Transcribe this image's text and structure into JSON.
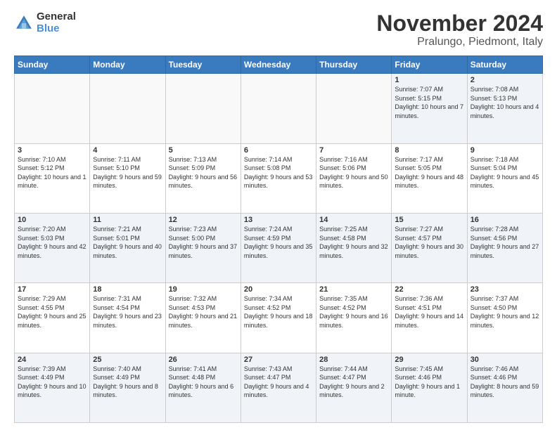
{
  "logo": {
    "general": "General",
    "blue": "Blue"
  },
  "title": "November 2024",
  "subtitle": "Pralungo, Piedmont, Italy",
  "days_header": [
    "Sunday",
    "Monday",
    "Tuesday",
    "Wednesday",
    "Thursday",
    "Friday",
    "Saturday"
  ],
  "weeks": [
    [
      {
        "day": "",
        "info": ""
      },
      {
        "day": "",
        "info": ""
      },
      {
        "day": "",
        "info": ""
      },
      {
        "day": "",
        "info": ""
      },
      {
        "day": "",
        "info": ""
      },
      {
        "day": "1",
        "info": "Sunrise: 7:07 AM\nSunset: 5:15 PM\nDaylight: 10 hours and 7 minutes."
      },
      {
        "day": "2",
        "info": "Sunrise: 7:08 AM\nSunset: 5:13 PM\nDaylight: 10 hours and 4 minutes."
      }
    ],
    [
      {
        "day": "3",
        "info": "Sunrise: 7:10 AM\nSunset: 5:12 PM\nDaylight: 10 hours and 1 minute."
      },
      {
        "day": "4",
        "info": "Sunrise: 7:11 AM\nSunset: 5:10 PM\nDaylight: 9 hours and 59 minutes."
      },
      {
        "day": "5",
        "info": "Sunrise: 7:13 AM\nSunset: 5:09 PM\nDaylight: 9 hours and 56 minutes."
      },
      {
        "day": "6",
        "info": "Sunrise: 7:14 AM\nSunset: 5:08 PM\nDaylight: 9 hours and 53 minutes."
      },
      {
        "day": "7",
        "info": "Sunrise: 7:16 AM\nSunset: 5:06 PM\nDaylight: 9 hours and 50 minutes."
      },
      {
        "day": "8",
        "info": "Sunrise: 7:17 AM\nSunset: 5:05 PM\nDaylight: 9 hours and 48 minutes."
      },
      {
        "day": "9",
        "info": "Sunrise: 7:18 AM\nSunset: 5:04 PM\nDaylight: 9 hours and 45 minutes."
      }
    ],
    [
      {
        "day": "10",
        "info": "Sunrise: 7:20 AM\nSunset: 5:03 PM\nDaylight: 9 hours and 42 minutes."
      },
      {
        "day": "11",
        "info": "Sunrise: 7:21 AM\nSunset: 5:01 PM\nDaylight: 9 hours and 40 minutes."
      },
      {
        "day": "12",
        "info": "Sunrise: 7:23 AM\nSunset: 5:00 PM\nDaylight: 9 hours and 37 minutes."
      },
      {
        "day": "13",
        "info": "Sunrise: 7:24 AM\nSunset: 4:59 PM\nDaylight: 9 hours and 35 minutes."
      },
      {
        "day": "14",
        "info": "Sunrise: 7:25 AM\nSunset: 4:58 PM\nDaylight: 9 hours and 32 minutes."
      },
      {
        "day": "15",
        "info": "Sunrise: 7:27 AM\nSunset: 4:57 PM\nDaylight: 9 hours and 30 minutes."
      },
      {
        "day": "16",
        "info": "Sunrise: 7:28 AM\nSunset: 4:56 PM\nDaylight: 9 hours and 27 minutes."
      }
    ],
    [
      {
        "day": "17",
        "info": "Sunrise: 7:29 AM\nSunset: 4:55 PM\nDaylight: 9 hours and 25 minutes."
      },
      {
        "day": "18",
        "info": "Sunrise: 7:31 AM\nSunset: 4:54 PM\nDaylight: 9 hours and 23 minutes."
      },
      {
        "day": "19",
        "info": "Sunrise: 7:32 AM\nSunset: 4:53 PM\nDaylight: 9 hours and 21 minutes."
      },
      {
        "day": "20",
        "info": "Sunrise: 7:34 AM\nSunset: 4:52 PM\nDaylight: 9 hours and 18 minutes."
      },
      {
        "day": "21",
        "info": "Sunrise: 7:35 AM\nSunset: 4:52 PM\nDaylight: 9 hours and 16 minutes."
      },
      {
        "day": "22",
        "info": "Sunrise: 7:36 AM\nSunset: 4:51 PM\nDaylight: 9 hours and 14 minutes."
      },
      {
        "day": "23",
        "info": "Sunrise: 7:37 AM\nSunset: 4:50 PM\nDaylight: 9 hours and 12 minutes."
      }
    ],
    [
      {
        "day": "24",
        "info": "Sunrise: 7:39 AM\nSunset: 4:49 PM\nDaylight: 9 hours and 10 minutes."
      },
      {
        "day": "25",
        "info": "Sunrise: 7:40 AM\nSunset: 4:49 PM\nDaylight: 9 hours and 8 minutes."
      },
      {
        "day": "26",
        "info": "Sunrise: 7:41 AM\nSunset: 4:48 PM\nDaylight: 9 hours and 6 minutes."
      },
      {
        "day": "27",
        "info": "Sunrise: 7:43 AM\nSunset: 4:47 PM\nDaylight: 9 hours and 4 minutes."
      },
      {
        "day": "28",
        "info": "Sunrise: 7:44 AM\nSunset: 4:47 PM\nDaylight: 9 hours and 2 minutes."
      },
      {
        "day": "29",
        "info": "Sunrise: 7:45 AM\nSunset: 4:46 PM\nDaylight: 9 hours and 1 minute."
      },
      {
        "day": "30",
        "info": "Sunrise: 7:46 AM\nSunset: 4:46 PM\nDaylight: 8 hours and 59 minutes."
      }
    ]
  ]
}
